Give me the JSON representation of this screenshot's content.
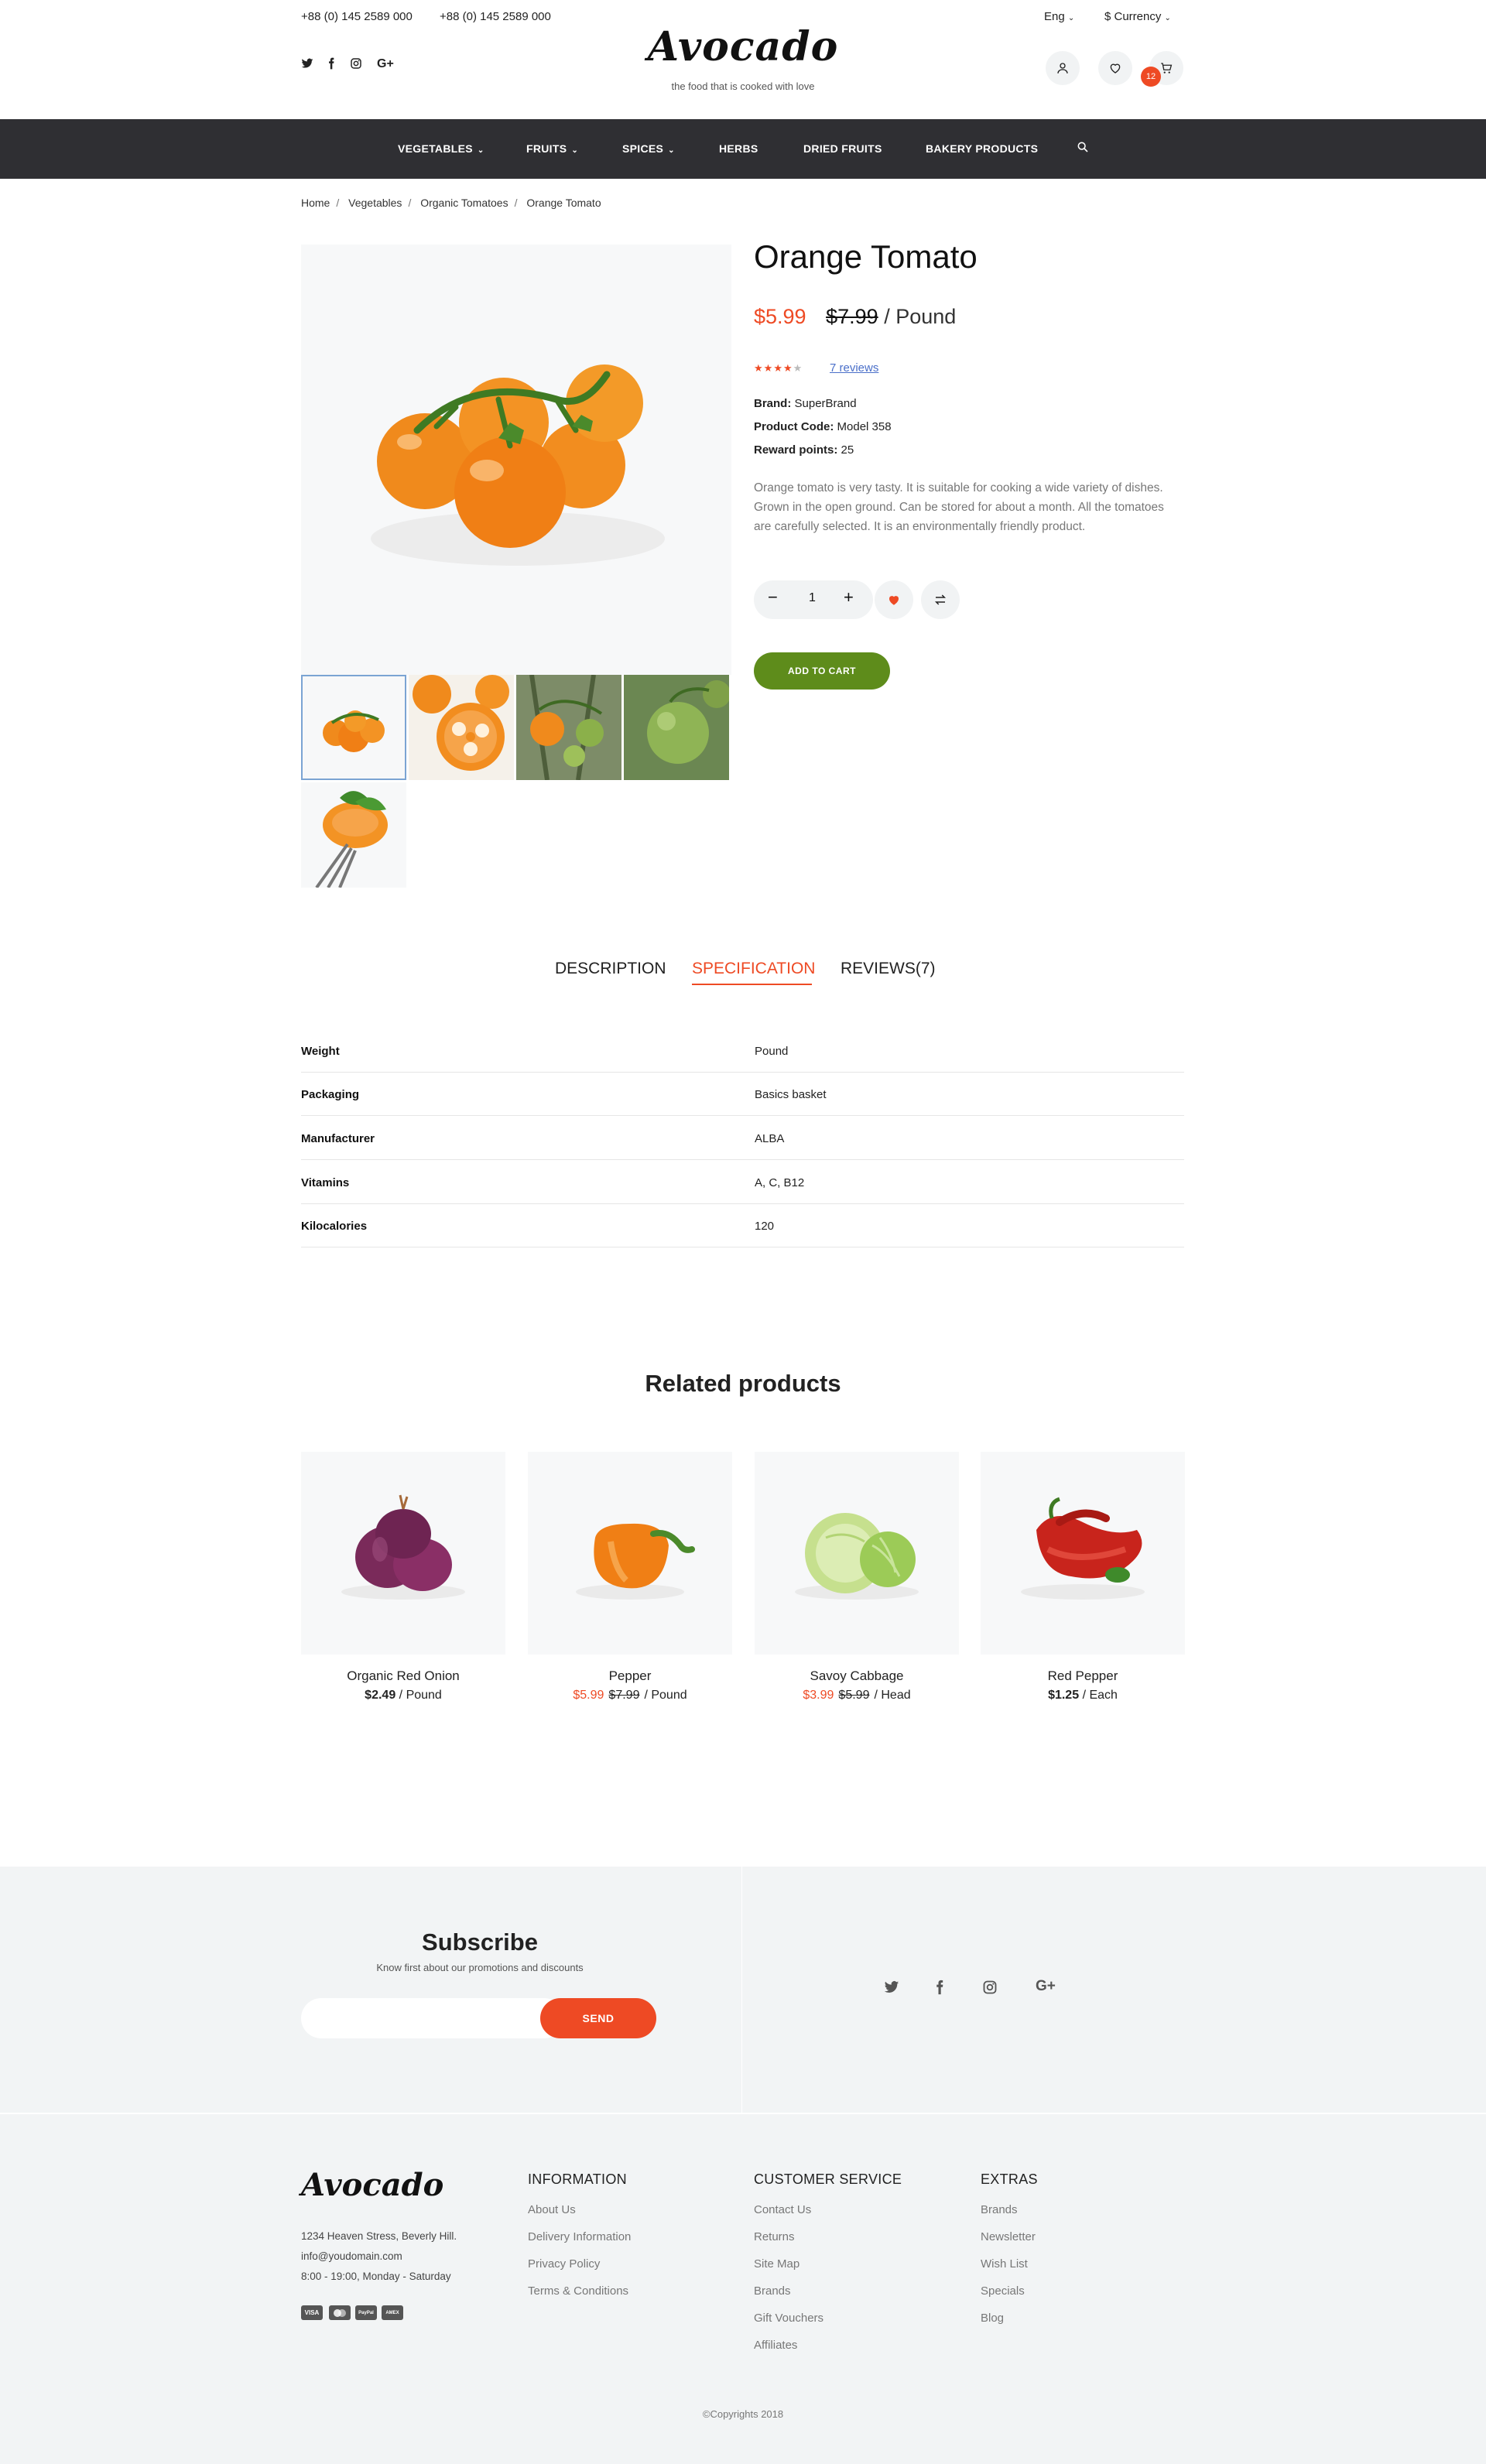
{
  "header": {
    "phone1": "+88 (0) 145 2589 000",
    "phone2": "+88 (0) 145 2589 000",
    "logo": "Avocado",
    "tagline": "the food that is cooked with love",
    "language": "Eng",
    "currency": "$  Currency",
    "cart_count": "12"
  },
  "nav": {
    "items": [
      {
        "label": "VEGETABLES",
        "has_dropdown": true
      },
      {
        "label": "FRUITS",
        "has_dropdown": true
      },
      {
        "label": "SPICES",
        "has_dropdown": true
      },
      {
        "label": "HERBS",
        "has_dropdown": false
      },
      {
        "label": "DRIED FRUITS",
        "has_dropdown": false
      },
      {
        "label": "BAKERY PRODUCTS",
        "has_dropdown": false
      }
    ]
  },
  "breadcrumb": [
    "Home",
    "Vegetables",
    "Organic Tomatoes",
    "Orange Tomato"
  ],
  "product": {
    "title": "Orange Tomato",
    "price_new": "$5.99",
    "price_old": "$7.99",
    "unit": "/ Pound",
    "rating": 4,
    "rating_max": 5,
    "reviews_link": "7 reviews",
    "brand_label": "Brand:",
    "brand": "SuperBrand",
    "code_label": "Product Code:",
    "code": "Model 358",
    "reward_label": "Reward points:",
    "reward": "25",
    "description": "Orange tomato is very tasty. It is suitable for cooking a wide variety of dishes. Grown in the open ground. Can be stored for about a month. All the tomatoes are carefully selected. It is an environmentally friendly product.",
    "quantity": "1",
    "add_to_cart": "ADD TO CART"
  },
  "tabs": [
    {
      "label": "DESCRIPTION",
      "active": false
    },
    {
      "label": "SPECIFICATION",
      "active": true
    },
    {
      "label": "REVIEWS(7)",
      "active": false
    }
  ],
  "specification": [
    {
      "key": "Weight",
      "value": "Pound"
    },
    {
      "key": "Packaging",
      "value": "Basics basket"
    },
    {
      "key": "Manufacturer",
      "value": "ALBA"
    },
    {
      "key": "Vitamins",
      "value": "A, C, B12"
    },
    {
      "key": "Kilocalories",
      "value": "120"
    }
  ],
  "related": {
    "title": "Related products",
    "items": [
      {
        "name": "Organic Red Onion",
        "price": "$2.49",
        "old_price": "",
        "unit": "/ Pound",
        "on_sale": false
      },
      {
        "name": "Pepper",
        "price": "$5.99",
        "old_price": "$7.99",
        "unit": "/ Pound",
        "on_sale": true
      },
      {
        "name": "Savoy Cabbage",
        "price": "$3.99",
        "old_price": "$5.99",
        "unit": "/ Head",
        "on_sale": true
      },
      {
        "name": "Red Pepper",
        "price": "$1.25",
        "old_price": "",
        "unit": "/ Each",
        "on_sale": false
      }
    ]
  },
  "subscribe": {
    "title": "Subscribe",
    "text": "Know first about our promotions and discounts",
    "input_placeholder": "",
    "button": "SEND"
  },
  "footer": {
    "logo": "Avocado",
    "address": "1234 Heaven Stress, Beverly Hill.",
    "email": "info@youdomain.com",
    "hours": "8:00 - 19:00, Monday - Saturday",
    "payments": [
      "VISA",
      "MC",
      "PayPal",
      "AMEX"
    ],
    "columns": [
      {
        "title": "INFORMATION",
        "links": [
          "About Us",
          "Delivery Information",
          "Privacy Policy",
          "Terms & Conditions"
        ]
      },
      {
        "title": "CUSTOMER SERVICE",
        "links": [
          "Contact Us",
          "Returns",
          "Site Map",
          "Brands",
          "Gift Vouchers",
          "Affiliates"
        ]
      },
      {
        "title": "EXTRAS",
        "links": [
          "Brands",
          "Newsletter",
          "Wish List",
          "Specials",
          "Blog"
        ]
      }
    ],
    "copyright": "©Copyrights 2018"
  },
  "colors": {
    "accent": "#ee4a24",
    "nav_bg": "#2f2f33",
    "add_to_cart_bg": "#5e8c1b",
    "band_bg": "#f2f4f5"
  }
}
